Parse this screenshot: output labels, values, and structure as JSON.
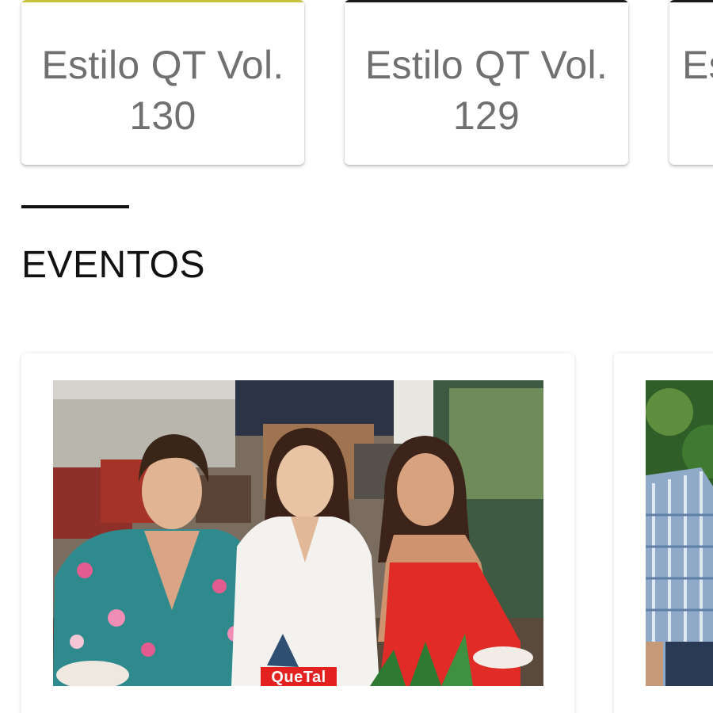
{
  "magazines": [
    {
      "title_line1": "Estilo QT Vol.",
      "title_line2": "130",
      "accent": "#c8c23a"
    },
    {
      "title_line1": "Estilo QT Vol.",
      "title_line2": "129",
      "accent": "#1a1a1a"
    },
    {
      "title_line1": "Es",
      "title_line2": "",
      "accent": "#1a1a1a"
    }
  ],
  "section": {
    "title": "EVENTOS"
  },
  "events": [
    {
      "watermark": "QueTal"
    }
  ],
  "colors": {
    "card_title": "#707070",
    "heading": "#111111",
    "brand_red": "#e3211f"
  }
}
